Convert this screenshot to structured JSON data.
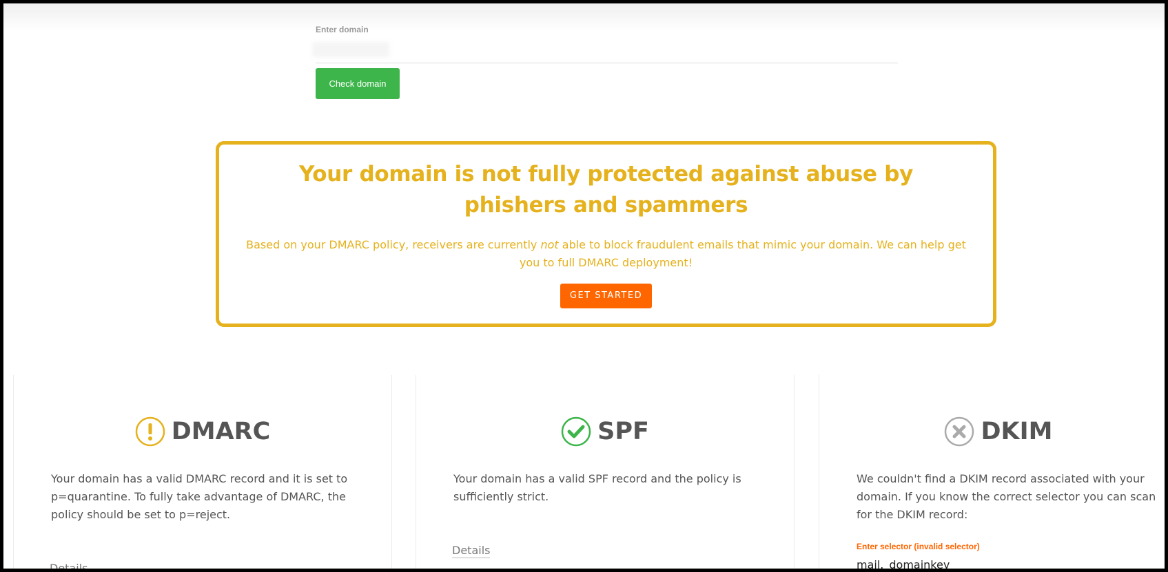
{
  "domain_form": {
    "label": "Enter domain",
    "input_value": "",
    "check_button": "Check domain"
  },
  "alert": {
    "title": "Your domain is not fully protected against abuse by phishers and spammers",
    "text_before": "Based on your DMARC policy, receivers are currently ",
    "text_emphasis": "not",
    "text_after": " able to block fraudulent emails that mimic your domain. We can help get you to full DMARC deployment!",
    "button": "GET STARTED",
    "color": "#e5b11c",
    "button_color": "#ff6600"
  },
  "checks": {
    "dmarc": {
      "title": "DMARC",
      "status_icon": "warning-icon",
      "status_color": "#e5b11c",
      "description": "Your domain has a valid DMARC record and it is set to p=quarantine. To fully take advantage of DMARC, the policy should be set to p=reject.",
      "details": "Details"
    },
    "spf": {
      "title": "SPF",
      "status_icon": "check-icon",
      "status_color": "#3db54a",
      "description": "Your domain has a valid SPF record and the policy is sufficiently strict.",
      "details": "Details"
    },
    "dkim": {
      "title": "DKIM",
      "status_icon": "error-icon",
      "status_color": "#aaaaaa",
      "description": "We couldn't find a DKIM record associated with your domain. If you know the correct selector you can scan for the DKIM record:",
      "selector_label": "Enter selector (invalid selector)",
      "selector_value": "mail._domainkey"
    }
  }
}
